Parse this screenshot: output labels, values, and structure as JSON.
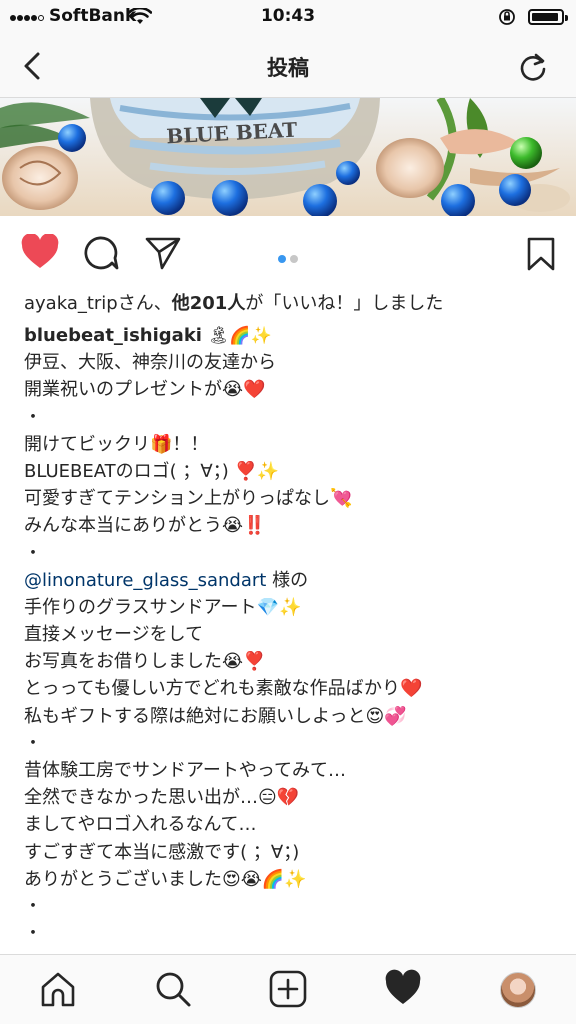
{
  "status_bar": {
    "carrier": "SoftBank",
    "time": "10:43"
  },
  "header": {
    "title": "投稿"
  },
  "photo": {
    "logo_text": "BLUE BEAT"
  },
  "likes": {
    "user": "ayaka_trip",
    "mid": "さん、",
    "others": "他201人",
    "suffix": "が「いいね！」しました"
  },
  "caption": {
    "username": "bluebeat_ishigaki",
    "username_emoji": "🏝🌈✨",
    "lines": [
      "伊豆、大阪、神奈川の友達から",
      "開業祝いのプレゼントが😭❤️",
      "・",
      "開けてビックリ🎁！！",
      "BLUEBEATのロゴ( ；∀；) ❣️✨",
      "可愛すぎてテンション上がりっぱなし💘",
      "みんな本当にありがとう😭‼️",
      "・"
    ],
    "mention": "@linonature_glass_sandart",
    "mention_suffix": " 様の",
    "lines2": [
      "手作りのグラスサンドアート💎✨",
      "直接メッセージをして",
      "お写真をお借りしました😭❣️",
      "とっっても優しい方でどれも素敵な作品ばかり❤️",
      "私もギフトする際は絶対にお願いしよっと😍💞",
      "・",
      "昔体験工房でサンドアートやってみて…",
      "全然できなかった思い出が…😑💔",
      "ましてやロゴ入れるなんて…",
      "すごすぎて本当に感激です( ；∀；)",
      "ありがとうございました😍😭🌈✨",
      "・",
      "・"
    ]
  },
  "colors": {
    "like_red": "#ed4956",
    "link_blue": "#003569",
    "dot_active": "#3897f0",
    "dot_inactive": "#c7c7c7"
  },
  "icons": [
    "back-icon",
    "refresh-icon",
    "heart-icon",
    "comment-icon",
    "share-icon",
    "bookmark-icon",
    "home-icon",
    "search-icon",
    "add-icon",
    "activity-heart-icon",
    "profile-avatar"
  ]
}
